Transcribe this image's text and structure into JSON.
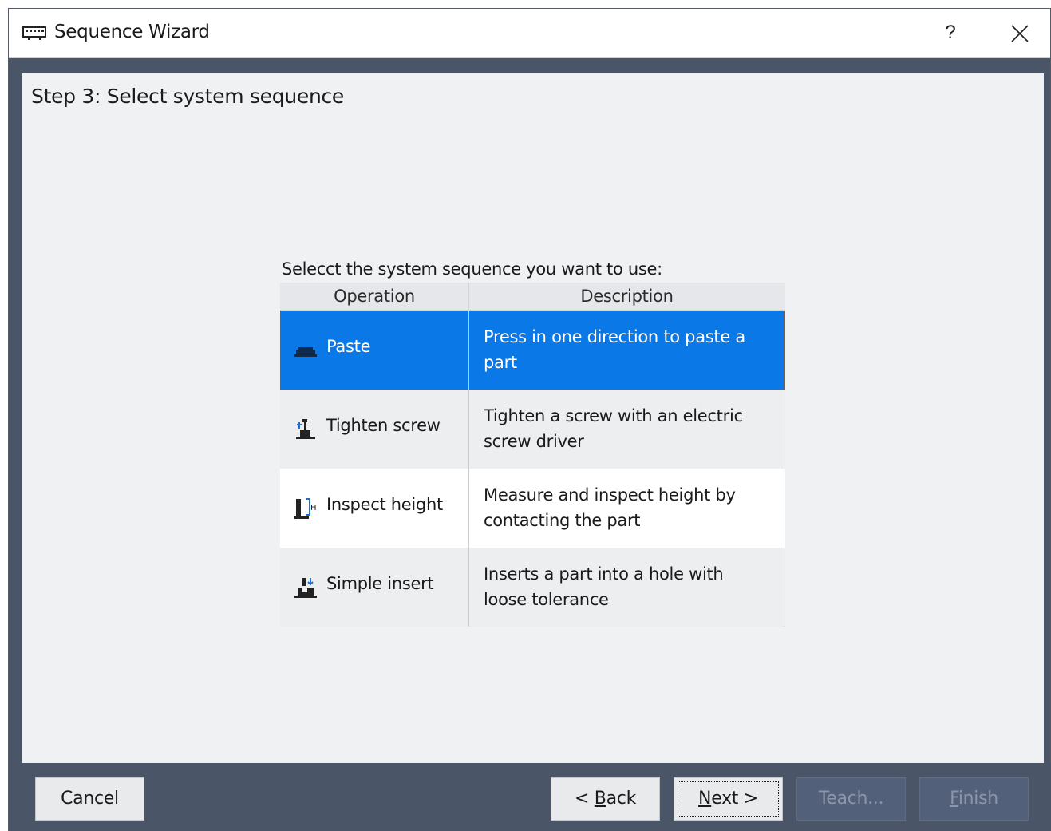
{
  "window": {
    "title": "Sequence Wizard",
    "help_label": "?",
    "icon": "keyboard-icon"
  },
  "content": {
    "step_title": "Step 3: Select system sequence",
    "prompt": "Selecct the system sequence you want to use:"
  },
  "grid": {
    "columns": [
      "Operation",
      "Description"
    ],
    "rows": [
      {
        "operation": "Paste",
        "description": "Press in one direction to paste a part",
        "icon": "paste-icon",
        "selected": true
      },
      {
        "operation": "Tighten screw",
        "description": "Tighten a screw with an electric screw driver",
        "icon": "tighten-screw-icon",
        "selected": false
      },
      {
        "operation": "Inspect height",
        "description": "Measure and inspect height by contacting the part",
        "icon": "inspect-height-icon",
        "selected": false
      },
      {
        "operation": "Simple insert",
        "description": "Inserts a part into a hole with loose tolerance",
        "icon": "simple-insert-icon",
        "selected": false
      }
    ]
  },
  "buttons": {
    "cancel": "Cancel",
    "back_prefix": "< ",
    "back_mnemonic": "B",
    "back_rest": "ack",
    "next_mnemonic": "N",
    "next_rest": "ext >",
    "teach": "Teach...",
    "finish_mnemonic": "F",
    "finish_rest": "inish"
  },
  "colors": {
    "selection": "#0a78e6",
    "frame": "#4a5568",
    "content_bg": "#f0f1f3"
  }
}
